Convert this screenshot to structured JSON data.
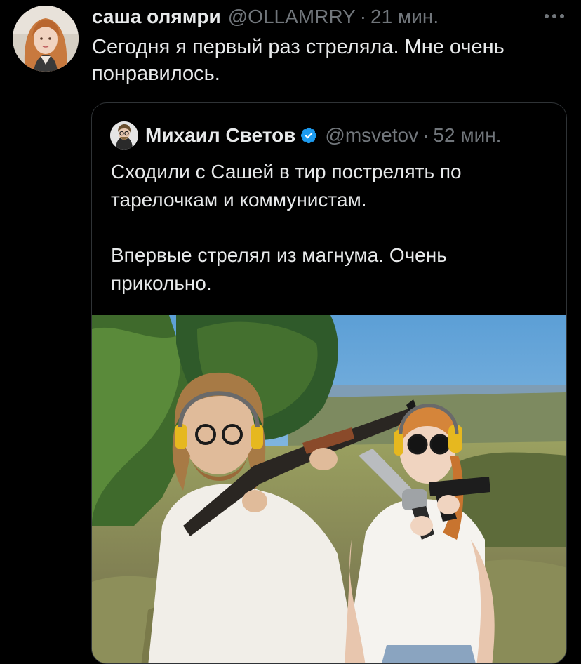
{
  "tweet": {
    "author_name": "саша олямри",
    "author_handle": "@OLLAMRRY",
    "separator": "·",
    "time": "21 мин.",
    "more_icon": "more-horizontal-icon",
    "text": "Сегодня я первый раз стреляла. Мне очень понравилось."
  },
  "quote": {
    "author_name": "Михаил Светов",
    "verified_icon": "verified-badge-icon",
    "verified_color": "#1d9bf0",
    "author_handle": "@msvetov",
    "separator": "·",
    "time": "52 мин.",
    "paragraph_1": "Сходили с Сашей в тир пострелять по тарелочкам и коммунистам.",
    "paragraph_2": "Впервые стрелял из магнума. Очень прикольно."
  },
  "colors": {
    "background": "#000000",
    "primary_text": "#e7e9ea",
    "secondary_text": "#71767b",
    "border": "#2f3336"
  }
}
